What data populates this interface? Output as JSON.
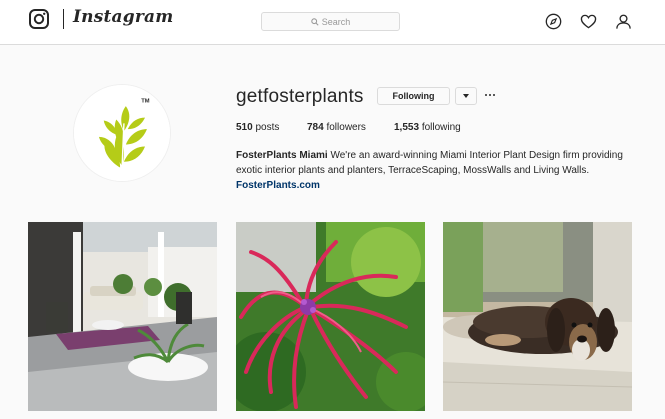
{
  "nav": {
    "brand": "Instagram",
    "search_placeholder": "Search",
    "icons": [
      "instagram-logo-icon",
      "explore-compass-icon",
      "heart-icon",
      "user-icon"
    ]
  },
  "profile": {
    "username": "getfosterplants",
    "follow_label": "Following",
    "stats": {
      "posts_count": "510",
      "posts_label": "posts",
      "followers_count": "784",
      "followers_label": "followers",
      "following_count": "1,553",
      "following_label": "following"
    },
    "bio": {
      "name": "FosterPlants Miami",
      "text": "We're an award-winning Miami Interior Plant Design firm providing exotic interior plants and planters, TerraceScaping, MossWalls and Living Walls.",
      "link": "FosterPlants.com"
    },
    "avatar_mark": "TM"
  },
  "posts": [
    {
      "subject": "interior-lounge-with-plants"
    },
    {
      "subject": "pink-bromeliad-plant"
    },
    {
      "subject": "dog-lying-on-floor"
    }
  ],
  "colors": {
    "brand_green": "#b5cc18",
    "link": "#003569",
    "border": "#dbdbdb",
    "background": "#fafafa"
  }
}
